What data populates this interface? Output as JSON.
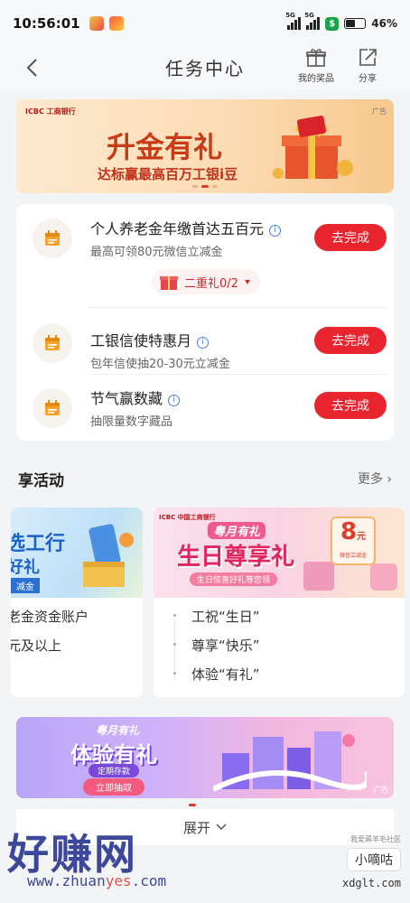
{
  "status": {
    "time": "10:56:01",
    "battery": "46%",
    "net1": "5G",
    "net2": "5G"
  },
  "header": {
    "title": "任务中心",
    "prizes_label": "我的奖品",
    "share_label": "分享"
  },
  "banner": {
    "bank": "ICBC 工商银行",
    "ad": "广告",
    "headline": "升金有礼",
    "sub": "达标赢最高百万工银i豆"
  },
  "tasks": [
    {
      "name": "个人养老金年缴首达五百元",
      "desc": "最高可领80元微信立减金",
      "button": "去完成",
      "info": "i"
    },
    {
      "name": "工银信使特惠月",
      "desc": "包年信使抽20-30元立减金",
      "button": "去完成",
      "info": "i"
    },
    {
      "name": "节气赢数藏",
      "desc": "抽限量数字藏品",
      "button": "去完成",
      "info": "i"
    }
  ],
  "bonus": {
    "label": "二重礼0/2"
  },
  "activities": {
    "title": "享活动",
    "more": "更多",
    "card1": {
      "headline1": "选工行",
      "headline2": "好礼",
      "tag": "减金",
      "lines": [
        "老金资金账户",
        "元及以上"
      ]
    },
    "card2": {
      "bank": "ICBC 中国工商银行",
      "kicker": "粤月有礼",
      "headline": "生日尊享礼",
      "tagline": "生日惊喜好礼等您领",
      "coupon_value": "8",
      "coupon_unit": "元",
      "coupon_label": "微信立减金",
      "lines": [
        "工祝“生日”",
        "尊享“快乐”",
        "体验“有礼”"
      ]
    }
  },
  "bottom_banner": {
    "kicker": "粤月有礼",
    "headline": "体验有礼",
    "tag": "定期存款",
    "cta": "立即抽取",
    "ad": "广告"
  },
  "expand_label": "展开",
  "watermark": {
    "brand": "好赚网",
    "url_pre": "www.zhuan",
    "url_mid": "yes",
    "url_post": ".com",
    "side_top": "我爱薅羊毛社区",
    "side_name": "小嘀咕",
    "side_url": "xdglt.com"
  }
}
